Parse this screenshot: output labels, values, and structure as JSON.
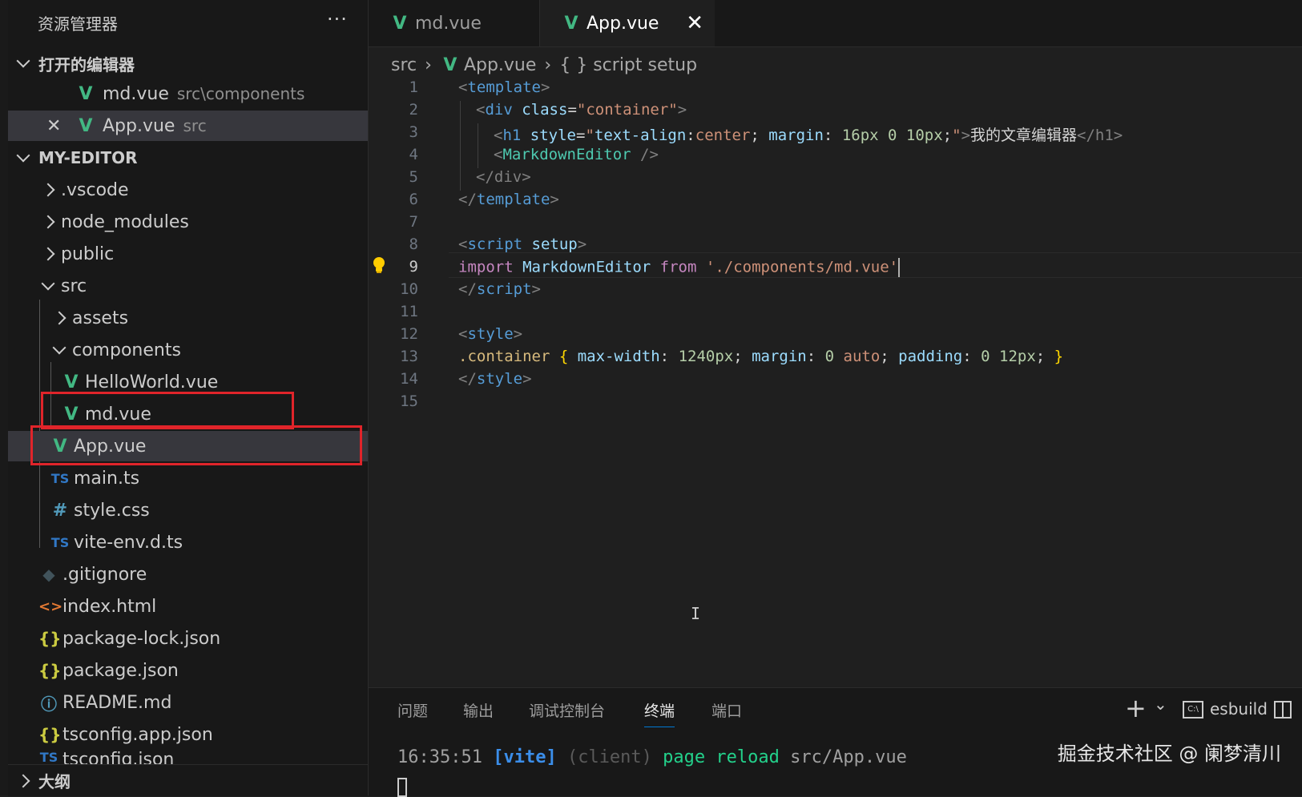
{
  "explorer": {
    "title": "资源管理器",
    "more": "···",
    "open_editors_label": "打开的编辑器",
    "open_editors": [
      {
        "name": "md.vue",
        "path": "src\\components"
      },
      {
        "name": "App.vue",
        "path": "src"
      }
    ],
    "project_label": "MY-EDITOR",
    "tree": [
      {
        "label": ".vscode",
        "kind": "folder"
      },
      {
        "label": "node_modules",
        "kind": "folder"
      },
      {
        "label": "public",
        "kind": "folder"
      },
      {
        "label": "src",
        "kind": "folder-open"
      },
      {
        "label": "assets",
        "kind": "folder"
      },
      {
        "label": "components",
        "kind": "folder-open"
      },
      {
        "label": "HelloWorld.vue",
        "kind": "vue"
      },
      {
        "label": "md.vue",
        "kind": "vue"
      },
      {
        "label": "App.vue",
        "kind": "vue"
      },
      {
        "label": "main.ts",
        "kind": "ts"
      },
      {
        "label": "style.css",
        "kind": "css"
      },
      {
        "label": "vite-env.d.ts",
        "kind": "ts"
      },
      {
        "label": ".gitignore",
        "kind": "git"
      },
      {
        "label": "index.html",
        "kind": "html"
      },
      {
        "label": "package-lock.json",
        "kind": "json"
      },
      {
        "label": "package.json",
        "kind": "json"
      },
      {
        "label": "README.md",
        "kind": "info"
      },
      {
        "label": "tsconfig.app.json",
        "kind": "json"
      },
      {
        "label": "tsconfig.json",
        "kind": "ts"
      }
    ],
    "outline_label": "大纲",
    "icons": {
      "vue": "V",
      "ts": "TS",
      "css": "#",
      "json": "{}",
      "info": "ⓘ",
      "git": "◆",
      "html": "<>"
    },
    "highlight_color": "#e0242a"
  },
  "tabs": [
    {
      "label": "md.vue",
      "active": false
    },
    {
      "label": "App.vue",
      "active": true,
      "close": "✕"
    }
  ],
  "breadcrumb": {
    "items": [
      "src",
      "App.vue",
      "{ } script setup"
    ],
    "sep": "›"
  },
  "editor": {
    "line_numbers": [
      "1",
      "2",
      "3",
      "4",
      "5",
      "6",
      "7",
      "8",
      "9",
      "10",
      "11",
      "12",
      "13",
      "14",
      "15"
    ],
    "current_line": "9",
    "code": {
      "l1_open": "<",
      "l1_tag": "template",
      "l1_close": ">",
      "l2_open": "<",
      "l2_tag": "div",
      "l2_attr": "class",
      "l2_eq": "=",
      "l2_val": "\"container\"",
      "l2_close": ">",
      "l3_open": "<",
      "l3_tag": "h1",
      "l3_attr": "style",
      "l3_eq": "=",
      "l3_q1": "\"",
      "l3_p1": "text-align",
      "l3_c1": ":",
      "l3_v1": "center",
      "l3_s1": "; ",
      "l3_p2": "margin",
      "l3_c2": ": ",
      "l3_v2": "16px 0 10px",
      "l3_s2": ";",
      "l3_q2": "\"",
      "l3_gt": ">",
      "l3_text": "我的文章编辑器",
      "l3_end": "</h1>",
      "l4_open": "<",
      "l4_tag": "MarkdownEditor",
      "l4_close": " />",
      "l5": "</div>",
      "l6_open": "</",
      "l6_tag": "template",
      "l6_close": ">",
      "l8_open": "<",
      "l8_tag": "script",
      "l8_attr": " setup",
      "l8_close": ">",
      "l9_kw": "import",
      "l9_name": " MarkdownEditor ",
      "l9_from": "from",
      "l9_str": " './components/md.vue'",
      "l10_open": "</",
      "l10_tag": "script",
      "l10_close": ">",
      "l12_open": "<",
      "l12_tag": "style",
      "l12_close": ">",
      "l13_sel": ".container",
      "l13_b1": " {",
      "l13_p1": " max-width",
      "l13_c1": ": ",
      "l13_v1": "1240px",
      "l13_s1": "; ",
      "l13_p2": "margin",
      "l13_c2": ": ",
      "l13_v2a": "0",
      "l13_v2b": " auto",
      "l13_s2": "; ",
      "l13_p3": "padding",
      "l13_c3": ": ",
      "l13_v3": "0 12px",
      "l13_s3": "; ",
      "l13_b2": "}",
      "l14_open": "</",
      "l14_tag": "style",
      "l14_close": ">"
    },
    "text_cursor": "I"
  },
  "panel": {
    "tabs": [
      "问题",
      "输出",
      "调试控制台",
      "终端",
      "端口"
    ],
    "active_tab": "终端",
    "add": "+",
    "dropdown": "⌄",
    "terminal_name": "esbuild",
    "terminal_icon_label": "C:\\",
    "log": {
      "time": "16:35:51",
      "tag": "[vite]",
      "client": "(client)",
      "msg": "page reload",
      "path": "src/App.vue"
    }
  },
  "watermark": "掘金技术社区 @ 阑梦清川"
}
